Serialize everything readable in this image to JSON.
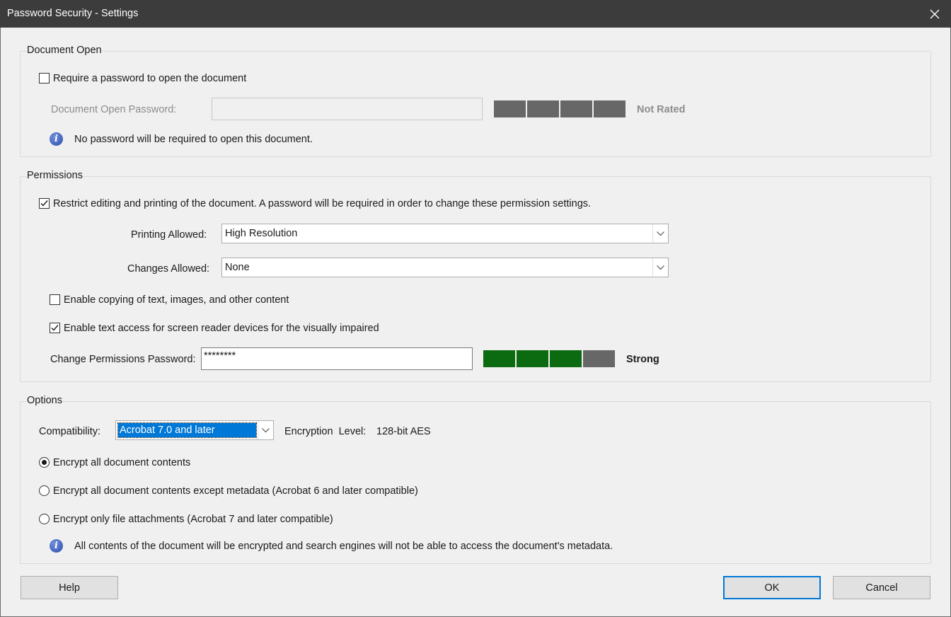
{
  "window": {
    "title": "Password Security - Settings"
  },
  "document_open": {
    "legend": "Document Open",
    "require_password_label": "Require a password to open the document",
    "require_password_checked": false,
    "password_label": "Document Open Password:",
    "password_value": "",
    "strength_label": "Not Rated",
    "info_text": "No password will be required to open this document."
  },
  "permissions": {
    "legend": "Permissions",
    "restrict_label": "Restrict editing and printing of the document. A password will be required in order to change these permission settings.",
    "restrict_checked": true,
    "printing_label": "Printing Allowed:",
    "printing_value": "High Resolution",
    "changes_label": "Changes Allowed:",
    "changes_value": "None",
    "copy_label": "Enable copying of text, images, and other content",
    "copy_checked": false,
    "screen_reader_label": "Enable text access for screen reader devices for the visually impaired",
    "screen_reader_checked": true,
    "password_label": "Change Permissions Password:",
    "password_value": "********",
    "strength_label": "Strong",
    "strength_level": "3 of 4"
  },
  "options": {
    "legend": "Options",
    "compat_label": "Compatibility:",
    "compat_value": "Acrobat 7.0 and later",
    "encryption_label": "Encryption  Level:",
    "encryption_value": "128-bit AES",
    "radio_all_label": "Encrypt all document contents",
    "radio_except_label": "Encrypt all document contents except metadata (Acrobat 6 and later compatible)",
    "radio_attach_label": "Encrypt only file attachments (Acrobat 7 and later compatible)",
    "selected_option": "Encrypt all document contents",
    "info_text": "All contents of the document will be encrypted and search engines will not be able to access the document's metadata."
  },
  "buttons": {
    "help": "Help",
    "ok": "OK",
    "cancel": "Cancel"
  },
  "colors": {
    "strength_green": "#0c6a10",
    "strength_empty": "#676767",
    "selection_blue": "#0078d7",
    "titlebar": "#3c3c3c"
  }
}
